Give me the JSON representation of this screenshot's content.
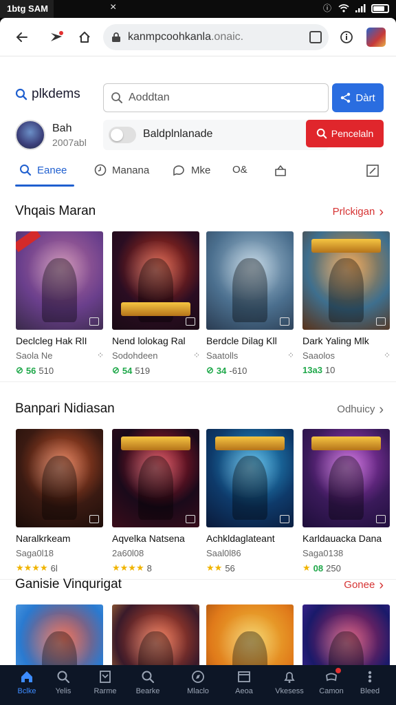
{
  "status": {
    "time": "1btg SAM",
    "close": "×"
  },
  "urlbar": {
    "url_main": "kanmpcoohkanla",
    "url_dim": ".onaic."
  },
  "search": {
    "brand": "plkdems",
    "placeholder": "Aoddtan",
    "button": "Dàrt"
  },
  "user": {
    "name": "Bah",
    "sub": "2007abl",
    "toggle_label": "Baldplnlanade",
    "red_button": "Pencelaln"
  },
  "tabs": [
    {
      "label": "Eanee",
      "icon": "search-icon"
    },
    {
      "label": "Manana",
      "icon": "clock-icon"
    },
    {
      "label": "Mke",
      "icon": "chat-icon"
    },
    {
      "label": "O&",
      "icon": "search-icon"
    },
    {
      "label": "",
      "icon": "bag-icon"
    },
    {
      "label": "",
      "icon": "edit-icon"
    }
  ],
  "sections": [
    {
      "title": "Vhqais Maran",
      "link": "Prlckigan",
      "link_color": "#d63333",
      "cards": [
        {
          "title": "Declcleg Hak RlI",
          "meta": "Saola Ne",
          "stat_icon": "⊘",
          "stat_strong": "56",
          "stat_text": "510",
          "colors": [
            "#6a3f8c",
            "#b56b9c",
            "#3a2a4a"
          ]
        },
        {
          "title": "Nend lolokag Ral",
          "meta": "Sodohdeen",
          "stat_icon": "⊘",
          "stat_strong": "54",
          "stat_text": "519",
          "colors": [
            "#2a0d22",
            "#c8341a",
            "#1a0a14"
          ]
        },
        {
          "title": "Berdcle Dilag Kll",
          "meta": "Saatolls",
          "stat_icon": "⊘",
          "stat_strong": "34",
          "stat_text": "-610",
          "colors": [
            "#4b6f8e",
            "#a8c3d6",
            "#2a3c52"
          ]
        },
        {
          "title": "Dark Yaling Mlk",
          "meta": "Saaolos",
          "stat_icon": "",
          "stat_strong": "13a3",
          "stat_text": "10",
          "colors": [
            "#3e6f8e",
            "#e08a2a",
            "#5a3218"
          ]
        }
      ]
    },
    {
      "title": "Banpari Nidiasan",
      "link": "Odhuicy",
      "link_color": "#666666",
      "cards": [
        {
          "title": "Naralkrkeam",
          "meta": "Saga0l18",
          "stars": "★★★★",
          "stat_text": "6l",
          "colors": [
            "#3a1a12",
            "#d0562a",
            "#1a0c08"
          ]
        },
        {
          "title": "Aqvelka Natsena",
          "meta": "2a60l08",
          "stars": "★★★★",
          "stat_text": "8",
          "colors": [
            "#1a0a1a",
            "#c21e2e",
            "#3a0c1a"
          ]
        },
        {
          "title": "Achkldaglateant",
          "meta": "Saal0l86",
          "stars": "★★",
          "stat_text": "56",
          "colors": [
            "#0e3a6a",
            "#2aa0d8",
            "#0a1a3a"
          ]
        },
        {
          "title": "Karldauacka Dana",
          "meta": "Saga0138",
          "stars": "★",
          "stat_strong": "08",
          "stat_text": "250",
          "colors": [
            "#3a1a5a",
            "#b040c8",
            "#1e0e3a"
          ]
        }
      ]
    },
    {
      "title": "Ganisie Vinqurigat",
      "link": "Gonee",
      "link_color": "#d63333",
      "cards": [
        {
          "colors": [
            "#2a7ad0",
            "#e0452a",
            "#6ab4f0"
          ]
        },
        {
          "colors": [
            "#3a1a2a",
            "#e0502a",
            "#f0a040"
          ]
        },
        {
          "colors": [
            "#e07a1a",
            "#f0c03a",
            "#8a3a0a"
          ]
        },
        {
          "colors": [
            "#1a1a6a",
            "#c02a5a",
            "#5a2ab0"
          ]
        }
      ]
    }
  ],
  "bottom_nav": [
    {
      "label": "Bclke",
      "icon": "home-icon",
      "active": true
    },
    {
      "label": "Yelis",
      "icon": "search-icon"
    },
    {
      "label": "Rarme",
      "icon": "gift-icon"
    },
    {
      "label": "Bearke",
      "icon": "search-icon"
    },
    {
      "label": "Mlaclo",
      "icon": "compass-icon"
    },
    {
      "label": "Aeoa",
      "icon": "window-icon"
    },
    {
      "label": "Vkesess",
      "icon": "bell-icon"
    },
    {
      "label": "Camon",
      "icon": "controller-icon",
      "badge": true
    },
    {
      "label": "Bleed",
      "icon": "more-icon"
    }
  ],
  "accent_colors": {
    "blue": "#2a6de0",
    "red": "#e0262c",
    "nav_bg": "#0d1626"
  }
}
